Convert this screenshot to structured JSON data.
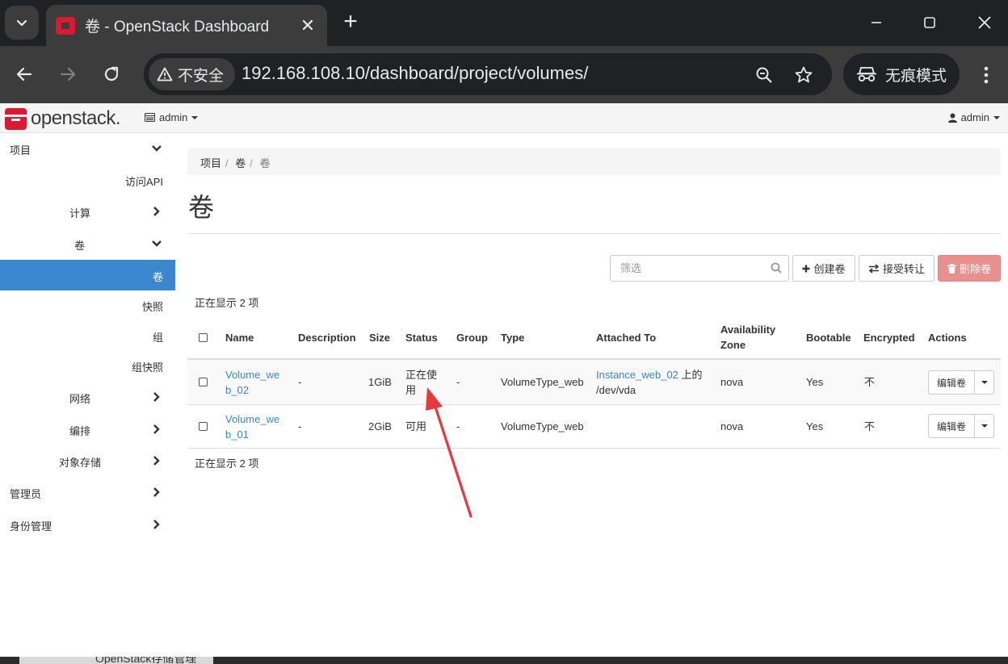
{
  "browser": {
    "tab_title": "卷 - OpenStack Dashboard",
    "security_label": "不安全",
    "url": "192.168.108.10/dashboard/project/volumes/",
    "incognito_label": "无痕模式"
  },
  "header": {
    "logo_text": "openstack.",
    "project": "admin",
    "user": "admin"
  },
  "sidebar": {
    "items": [
      {
        "label": "项目",
        "chevron": "down"
      },
      {
        "label": "访问API"
      },
      {
        "label": "计算",
        "chevron": "right"
      },
      {
        "label": "卷",
        "chevron": "down"
      },
      {
        "label": "卷",
        "active": true
      },
      {
        "label": "快照"
      },
      {
        "label": "组"
      },
      {
        "label": "组快照"
      },
      {
        "label": "网络",
        "chevron": "right"
      },
      {
        "label": "编排",
        "chevron": "right"
      },
      {
        "label": "对象存储",
        "chevron": "right"
      },
      {
        "label": "管理员",
        "chevron": "right"
      },
      {
        "label": "身份管理",
        "chevron": "right"
      }
    ]
  },
  "breadcrumb": [
    "项目",
    "卷",
    "卷"
  ],
  "page_title": "卷",
  "toolbar": {
    "filter_placeholder": "筛选",
    "create_label": "创建卷",
    "accept_transfer_label": "接受转让",
    "delete_label": "删除卷"
  },
  "count_text": "正在显示 2 项",
  "table": {
    "columns": [
      "Name",
      "Description",
      "Size",
      "Status",
      "Group",
      "Type",
      "Attached To",
      "Availability Zone",
      "Bootable",
      "Encrypted",
      "Actions"
    ],
    "rows": [
      {
        "name": "Volume_web_02",
        "description": "-",
        "size": "1GiB",
        "status": "正在使用",
        "group": "-",
        "type": "VolumeType_web",
        "attached_instance": "Instance_web_02",
        "attached_suffix": " 上的",
        "attached_device": "/dev/vda",
        "zone": "nova",
        "bootable": "Yes",
        "encrypted": "不",
        "action": "编辑卷"
      },
      {
        "name": "Volume_web_01",
        "description": "-",
        "size": "2GiB",
        "status": "可用",
        "group": "-",
        "type": "VolumeType_web",
        "attached_instance": "",
        "attached_suffix": "",
        "attached_device": "",
        "zone": "nova",
        "bootable": "Yes",
        "encrypted": "不",
        "action": "编辑卷"
      }
    ]
  },
  "background_window_text": "OpenStack存储管理",
  "colors": {
    "accent": "#3a87cd",
    "brand": "#da1a32",
    "danger": "#e8908e",
    "annotation_arrow": "#e8383d"
  }
}
